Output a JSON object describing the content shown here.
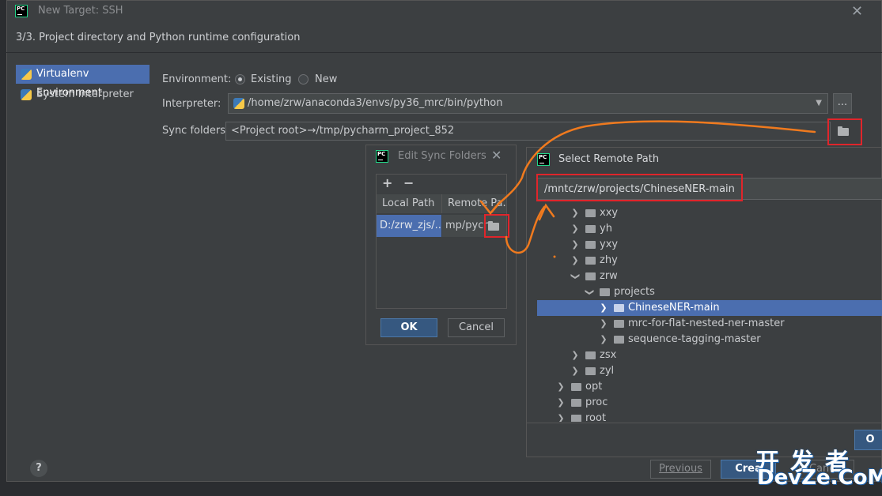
{
  "main_dialog": {
    "title": "New Target: SSH",
    "step": "3/3. Project directory and Python runtime configuration",
    "env_types": [
      {
        "label": "Virtualenv Environment"
      },
      {
        "label": "System Interpreter"
      }
    ],
    "environment_label": "Environment:",
    "existing_label": "Existing",
    "new_label": "New",
    "interpreter_label": "Interpreter:",
    "interpreter_value": "/home/zrw/anaconda3/envs/py36_mrc/bin/python",
    "browse_label": "...",
    "sync_label": "Sync folders:",
    "sync_value": "<Project root>→/tmp/pycharm_project_852",
    "help_label": "?",
    "previous_label": "Previous",
    "create_label": "Crea",
    "cancel_label": "Cancel"
  },
  "sync_dialog": {
    "title": "Edit Sync Folders",
    "add": "+",
    "remove": "−",
    "col_local": "Local Path",
    "col_remote": "Remote Pa...",
    "row_local": "D:/zrw_zjs/...",
    "row_remote": "mp/pych",
    "ok_label": "OK",
    "cancel_label": "Cancel"
  },
  "remote_dialog": {
    "title": "Select Remote Path",
    "path_value": "/mntc/zrw/projects/ChineseNER-main",
    "ok_partial": "O",
    "tree": [
      {
        "name": "xxy",
        "expanded": false
      },
      {
        "name": "yh",
        "expanded": false
      },
      {
        "name": "yxy",
        "expanded": false
      },
      {
        "name": "zhy",
        "expanded": false
      },
      {
        "name": "zrw",
        "expanded": true
      },
      {
        "name": "projects",
        "expanded": true
      },
      {
        "name": "ChineseNER-main",
        "expanded": false,
        "selected": true
      },
      {
        "name": "mrc-for-flat-nested-ner-master",
        "expanded": false
      },
      {
        "name": "sequence-tagging-master",
        "expanded": false
      },
      {
        "name": "zsx",
        "expanded": false
      },
      {
        "name": "zyl",
        "expanded": false
      },
      {
        "name": "opt",
        "expanded": false
      },
      {
        "name": "proc",
        "expanded": false
      },
      {
        "name": "root",
        "expanded": false
      }
    ]
  },
  "watermark": {
    "line1": "开发者",
    "line2": "DevZe.CoM"
  },
  "colors": {
    "annotation_red": "#e0252b",
    "annotation_orange": "#f07a1e",
    "selection_blue": "#4b6eaf"
  }
}
